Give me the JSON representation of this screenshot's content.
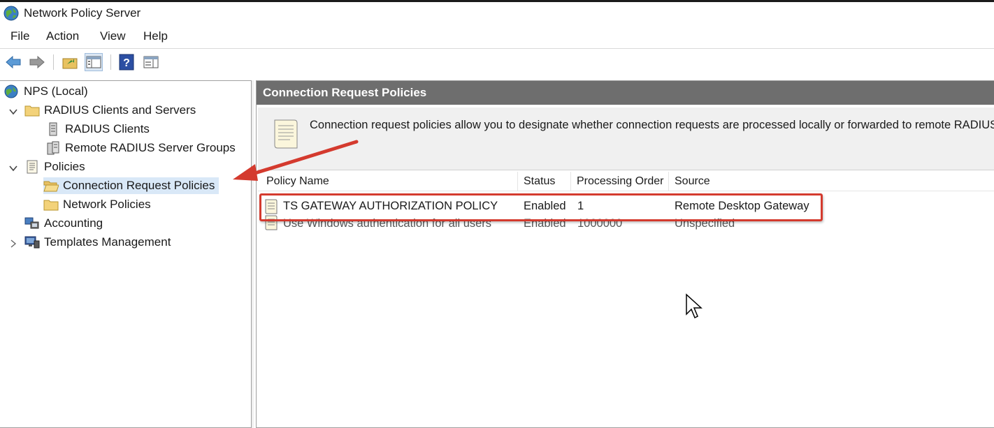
{
  "window": {
    "title": "Network Policy Server"
  },
  "menu": {
    "items": [
      "File",
      "Action",
      "View",
      "Help"
    ]
  },
  "toolbar": {
    "icons": [
      "back-arrow-icon",
      "forward-arrow-icon",
      "up-folder-icon",
      "show-hide-console-tree-icon",
      "help-icon",
      "action-pane-icon"
    ]
  },
  "tree": {
    "root": "NPS (Local)",
    "radius_group": "RADIUS Clients and Servers",
    "radius_clients": "RADIUS Clients",
    "remote_groups": "Remote RADIUS Server Groups",
    "policies": "Policies",
    "connection_request_policies": "Connection Request Policies",
    "network_policies": "Network Policies",
    "accounting": "Accounting",
    "templates_management": "Templates Management"
  },
  "detail": {
    "header": "Connection Request Policies",
    "description": "Connection request policies allow you to designate whether connection requests are processed locally or forwarded to remote RADIUS ser",
    "columns": [
      "Policy Name",
      "Status",
      "Processing Order",
      "Source"
    ],
    "rows": [
      {
        "name": "TS GATEWAY AUTHORIZATION POLICY",
        "status": "Enabled",
        "order": "1",
        "source": "Remote Desktop Gateway"
      },
      {
        "name": "Use Windows authentication for all users",
        "status": "Enabled",
        "order": "1000000",
        "source": "Unspecified"
      }
    ]
  },
  "colors": {
    "header_bg": "#6e6e6e",
    "highlight": "#d43a2e",
    "selection": "#d9e8f7"
  }
}
